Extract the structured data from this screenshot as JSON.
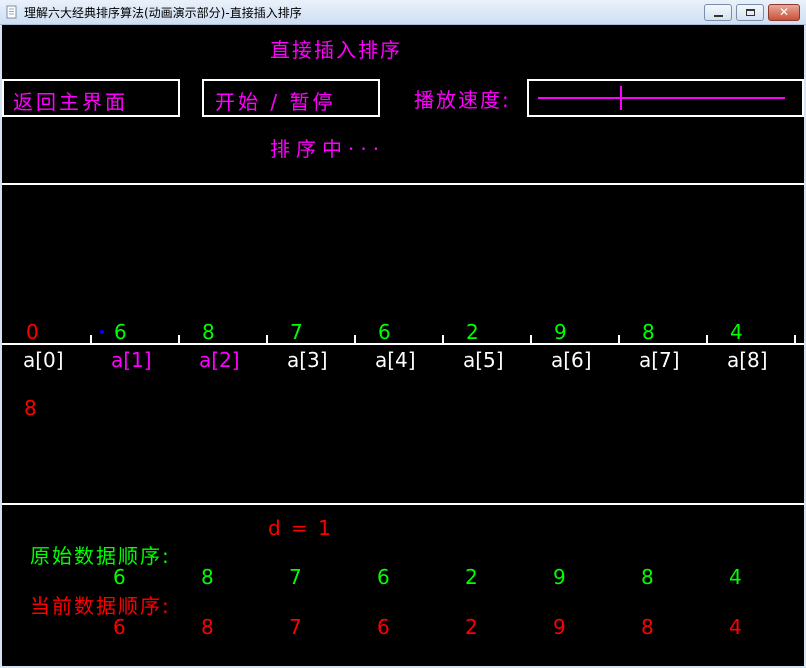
{
  "window": {
    "title": "理解六大经典排序算法(动画演示部分)-直接插入排序"
  },
  "header": {
    "title": "直接插入排序",
    "back_button": "返回主界面",
    "start_pause_button": "开始 / 暂停",
    "speed_label": "播放速度:",
    "speed_slider_text": "------+-------------",
    "status": "排序中···"
  },
  "sort_area": {
    "top_values": [
      "0",
      "6",
      "8",
      "7",
      "6",
      "2",
      "9",
      "8",
      "4"
    ],
    "indices": [
      "a[0]",
      "a[1]",
      "a[2]",
      "a[3]",
      "a[4]",
      "a[5]",
      "a[6]",
      "a[7]",
      "a[8]"
    ],
    "temp_value": "8"
  },
  "info": {
    "d_label": "d = 1",
    "original_label": "原始数据顺序:",
    "original_values": [
      "6",
      "8",
      "7",
      "6",
      "2",
      "9",
      "8",
      "4"
    ],
    "current_label": "当前数据顺序:",
    "current_values": [
      "6",
      "8",
      "7",
      "6",
      "2",
      "9",
      "8",
      "4"
    ]
  },
  "colors": {
    "background": "#000000",
    "highlight": "#ff00ff",
    "sentinel": "#ff0000",
    "value": "#00ff00",
    "text": "#ffffff",
    "marker": "#0000ff"
  },
  "icons": [
    "app-icon",
    "minimize-icon",
    "maximize-icon",
    "close-icon"
  ]
}
